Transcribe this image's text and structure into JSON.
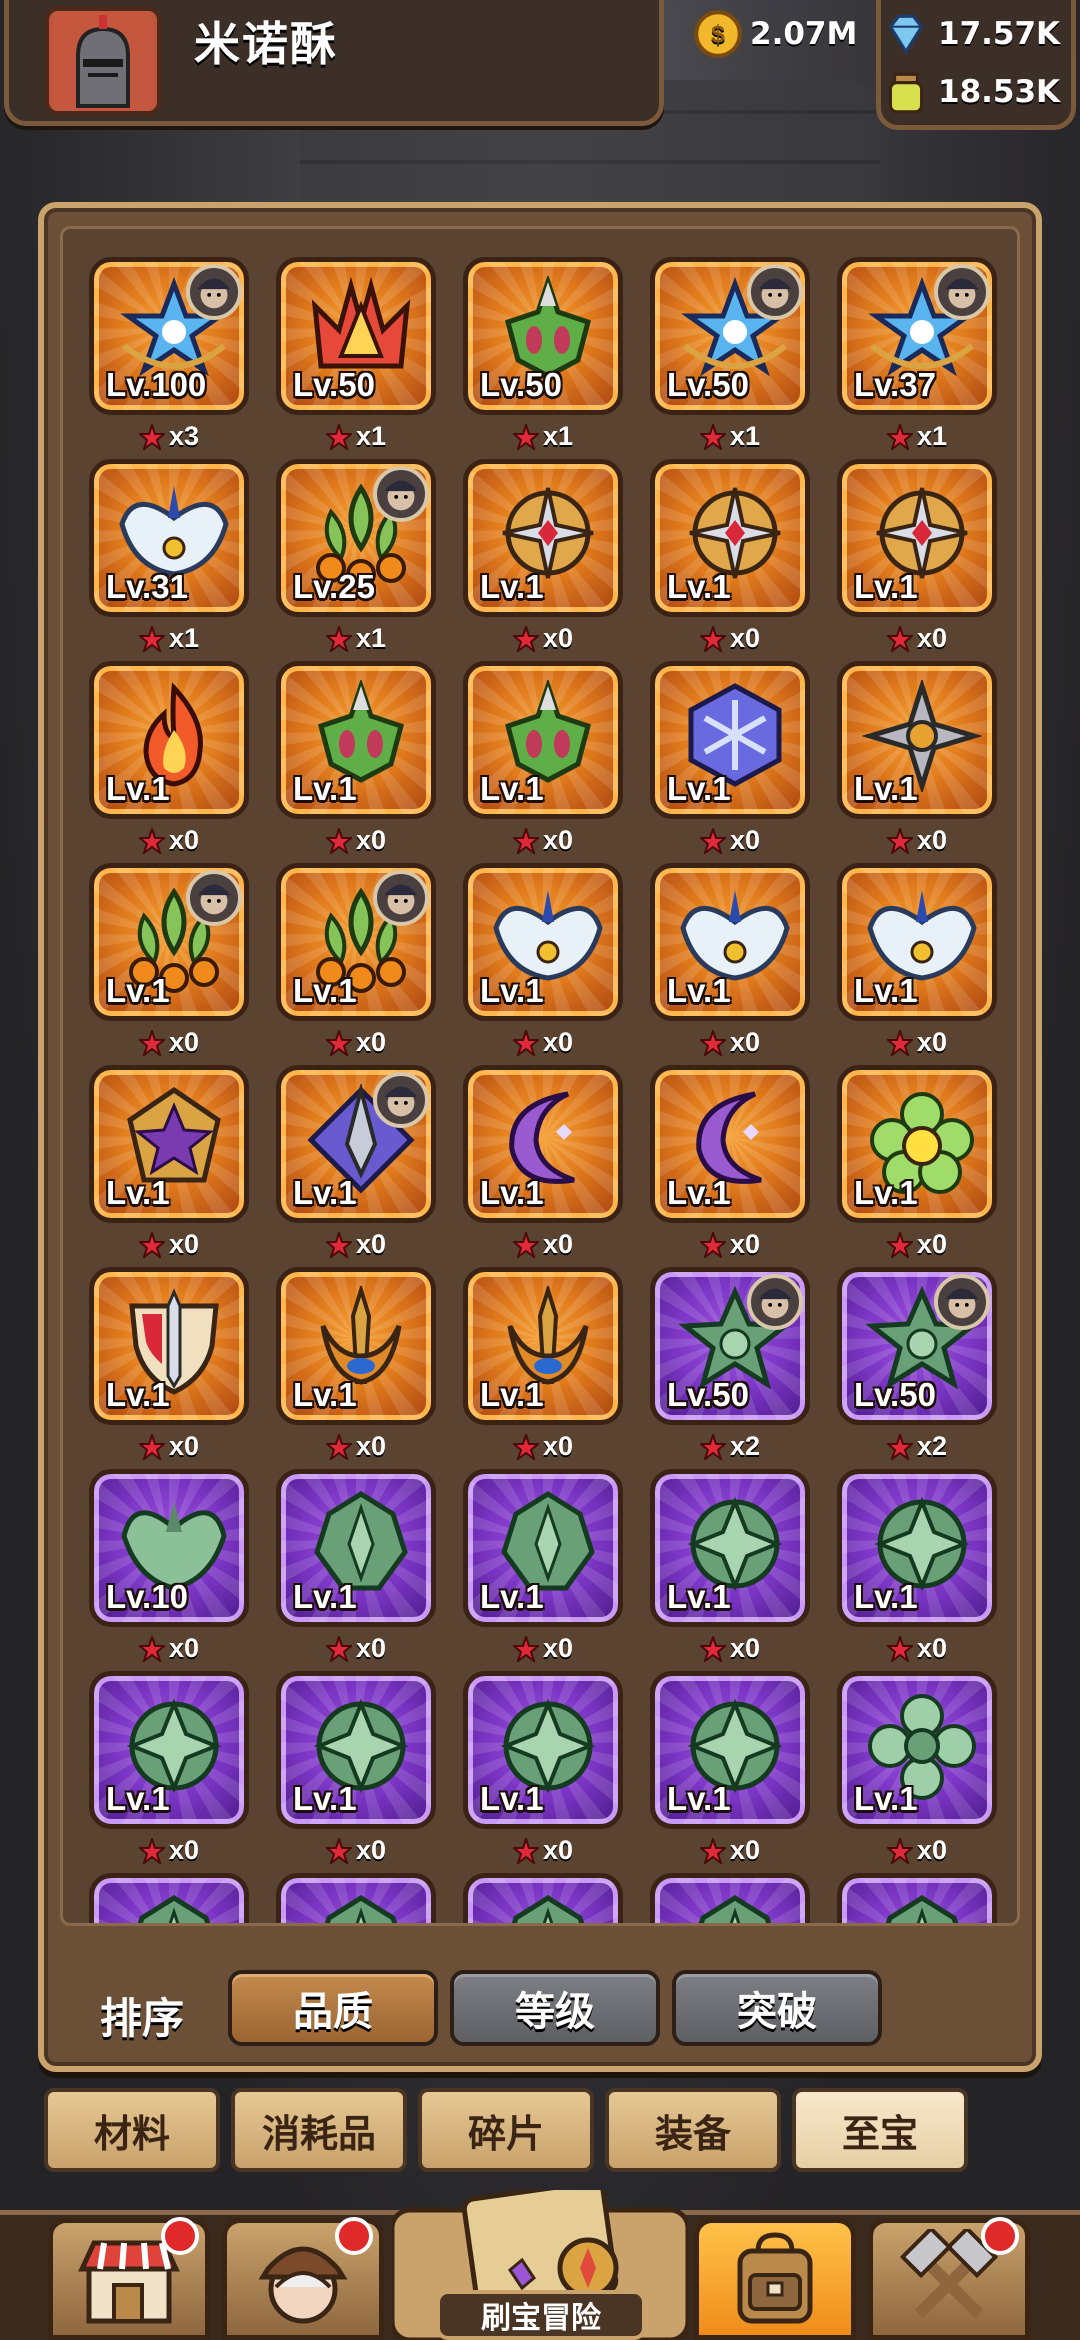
{
  "player": {
    "name": "米诺酥"
  },
  "currencies": [
    {
      "icon": "gold-coin-icon",
      "value": "2.07M"
    },
    {
      "icon": "blue-gem-icon",
      "value": "17.57K"
    },
    {
      "icon": "potion-jar-icon",
      "value": "18.53K"
    }
  ],
  "items": [
    {
      "rarity": "orange",
      "art": "star-emblem",
      "level": "Lv.100",
      "count": "x3",
      "hero": true
    },
    {
      "rarity": "orange",
      "art": "flame-crown",
      "level": "Lv.50",
      "count": "x1",
      "hero": false
    },
    {
      "rarity": "orange",
      "art": "green-crest",
      "level": "Lv.50",
      "count": "x1",
      "hero": false
    },
    {
      "rarity": "orange",
      "art": "star-emblem",
      "level": "Lv.50",
      "count": "x1",
      "hero": true
    },
    {
      "rarity": "orange",
      "art": "star-emblem",
      "level": "Lv.37",
      "count": "x1",
      "hero": true
    },
    {
      "rarity": "orange",
      "art": "wing-badge",
      "level": "Lv.31",
      "count": "x1",
      "hero": false
    },
    {
      "rarity": "orange",
      "art": "leaf-orbs",
      "level": "Lv.25",
      "count": "x1",
      "hero": true
    },
    {
      "rarity": "orange",
      "art": "cross-shield",
      "level": "Lv.1",
      "count": "x0",
      "hero": false
    },
    {
      "rarity": "orange",
      "art": "cross-shield",
      "level": "Lv.1",
      "count": "x0",
      "hero": false
    },
    {
      "rarity": "orange",
      "art": "cross-shield",
      "level": "Lv.1",
      "count": "x0",
      "hero": false
    },
    {
      "rarity": "orange",
      "art": "fire",
      "level": "Lv.1",
      "count": "x0",
      "hero": false
    },
    {
      "rarity": "orange",
      "art": "green-crest",
      "level": "Lv.1",
      "count": "x0",
      "hero": false
    },
    {
      "rarity": "orange",
      "art": "green-crest",
      "level": "Lv.1",
      "count": "x0",
      "hero": false
    },
    {
      "rarity": "orange",
      "art": "snow-hex",
      "level": "Lv.1",
      "count": "x0",
      "hero": false
    },
    {
      "rarity": "orange",
      "art": "shuriken",
      "level": "Lv.1",
      "count": "x0",
      "hero": false
    },
    {
      "rarity": "orange",
      "art": "leaf-orbs",
      "level": "Lv.1",
      "count": "x0",
      "hero": true
    },
    {
      "rarity": "orange",
      "art": "leaf-orbs",
      "level": "Lv.1",
      "count": "x0",
      "hero": true
    },
    {
      "rarity": "orange",
      "art": "wing-badge",
      "level": "Lv.1",
      "count": "x0",
      "hero": false
    },
    {
      "rarity": "orange",
      "art": "wing-badge",
      "level": "Lv.1",
      "count": "x0",
      "hero": false
    },
    {
      "rarity": "orange",
      "art": "wing-badge",
      "level": "Lv.1",
      "count": "x0",
      "hero": false
    },
    {
      "rarity": "orange",
      "art": "purple-star",
      "level": "Lv.1",
      "count": "x0",
      "hero": false
    },
    {
      "rarity": "orange",
      "art": "diamond-spear",
      "level": "Lv.1",
      "count": "x0",
      "hero": true
    },
    {
      "rarity": "orange",
      "art": "moon",
      "level": "Lv.1",
      "count": "x0",
      "hero": false
    },
    {
      "rarity": "orange",
      "art": "moon",
      "level": "Lv.1",
      "count": "x0",
      "hero": false
    },
    {
      "rarity": "orange",
      "art": "flower",
      "level": "Lv.1",
      "count": "x0",
      "hero": false
    },
    {
      "rarity": "orange",
      "art": "sword-shield",
      "level": "Lv.1",
      "count": "x0",
      "hero": false
    },
    {
      "rarity": "orange",
      "art": "trident",
      "level": "Lv.1",
      "count": "x0",
      "hero": false
    },
    {
      "rarity": "orange",
      "art": "trident",
      "level": "Lv.1",
      "count": "x0",
      "hero": false
    },
    {
      "rarity": "purple",
      "art": "jade-star",
      "level": "Lv.50",
      "count": "x2",
      "hero": true
    },
    {
      "rarity": "purple",
      "art": "jade-star",
      "level": "Lv.50",
      "count": "x2",
      "hero": true
    },
    {
      "rarity": "purple",
      "art": "jade-wings",
      "level": "Lv.10",
      "count": "x0",
      "hero": false
    },
    {
      "rarity": "purple",
      "art": "jade-crest",
      "level": "Lv.1",
      "count": "x0",
      "hero": false
    },
    {
      "rarity": "purple",
      "art": "jade-crest",
      "level": "Lv.1",
      "count": "x0",
      "hero": false
    },
    {
      "rarity": "purple",
      "art": "jade-cross",
      "level": "Lv.1",
      "count": "x0",
      "hero": false
    },
    {
      "rarity": "purple",
      "art": "jade-cross",
      "level": "Lv.1",
      "count": "x0",
      "hero": false
    },
    {
      "rarity": "purple",
      "art": "jade-cross",
      "level": "Lv.1",
      "count": "x0",
      "hero": false
    },
    {
      "rarity": "purple",
      "art": "jade-cross",
      "level": "Lv.1",
      "count": "x0",
      "hero": false
    },
    {
      "rarity": "purple",
      "art": "jade-cross",
      "level": "Lv.1",
      "count": "x0",
      "hero": false
    },
    {
      "rarity": "purple",
      "art": "jade-cross",
      "level": "Lv.1",
      "count": "x0",
      "hero": false
    },
    {
      "rarity": "purple",
      "art": "jade-flower",
      "level": "Lv.1",
      "count": "x0",
      "hero": false
    },
    {
      "rarity": "purple",
      "art": "jade-crest",
      "level": "",
      "count": "",
      "hero": false
    },
    {
      "rarity": "purple",
      "art": "jade-crest",
      "level": "",
      "count": "",
      "hero": false
    },
    {
      "rarity": "purple",
      "art": "jade-crest",
      "level": "",
      "count": "",
      "hero": false
    },
    {
      "rarity": "purple",
      "art": "jade-crest",
      "level": "",
      "count": "",
      "hero": false
    },
    {
      "rarity": "purple",
      "art": "jade-crest",
      "level": "",
      "count": "",
      "hero": false
    }
  ],
  "sort": {
    "label": "排序",
    "options": [
      "品质",
      "等级",
      "突破"
    ],
    "selected": "品质"
  },
  "categories": {
    "tabs": [
      "材料",
      "消耗品",
      "碎片",
      "装备",
      "至宝"
    ],
    "selected": "至宝"
  },
  "nav": {
    "items": [
      {
        "icon": "shop-icon",
        "badge": true
      },
      {
        "icon": "hero-portrait-icon",
        "badge": true
      },
      {
        "icon": "treasure-map-icon",
        "badge": false
      },
      {
        "icon": "backpack-icon",
        "badge": false,
        "active": true
      },
      {
        "icon": "forge-hammer-icon",
        "badge": true
      }
    ],
    "adventure_label": "刷宝冒险"
  },
  "colors": {
    "orange_tile": "#e07a1c",
    "purple_tile": "#7b35c4",
    "panel": "#6b4f36",
    "accent": "#c9a26c"
  }
}
